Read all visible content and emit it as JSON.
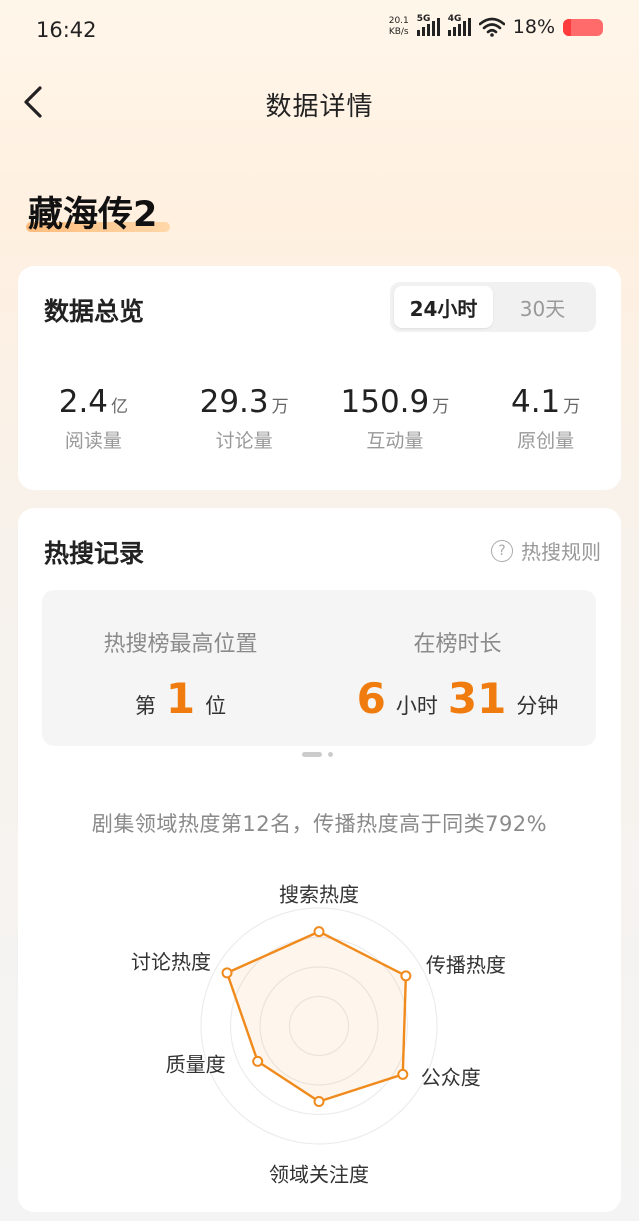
{
  "status_bar": {
    "time": "16:42",
    "net_speed_value": "20.1",
    "net_speed_unit": "KB/s",
    "signal1": "5G",
    "signal2": "4G",
    "battery": "18%"
  },
  "nav": {
    "title": "数据详情"
  },
  "topic": {
    "title": "藏海传2"
  },
  "overview": {
    "title": "数据总览",
    "tabs": [
      {
        "label": "24小时",
        "active": true
      },
      {
        "label": "30天",
        "active": false
      }
    ],
    "stats": [
      {
        "value": "2.4",
        "unit": "亿",
        "label": "阅读量"
      },
      {
        "value": "29.3",
        "unit": "万",
        "label": "讨论量"
      },
      {
        "value": "150.9",
        "unit": "万",
        "label": "互动量"
      },
      {
        "value": "4.1",
        "unit": "万",
        "label": "原创量"
      }
    ]
  },
  "hot_search": {
    "title": "热搜记录",
    "rules_label": "热搜规则",
    "rules_icon": "question-circle-icon",
    "peak_label": "热搜榜最高位置",
    "peak_prefix": "第",
    "peak_value": "1",
    "peak_suffix": "位",
    "duration_label": "在榜时长",
    "duration_hours": "6",
    "hours_unit": "小时",
    "duration_minutes": "31",
    "minutes_unit": "分钟",
    "summary": "剧集领域热度第12名，传播热度高于同类792%"
  },
  "radar": {
    "accent": "#f08a1c",
    "axes": [
      {
        "label": "搜索热度",
        "value": 0.8
      },
      {
        "label": "传播热度",
        "value": 0.85
      },
      {
        "label": "公众度",
        "value": 0.82
      },
      {
        "label": "领域关注度",
        "value": 0.64
      },
      {
        "label": "质量度",
        "value": 0.6
      },
      {
        "label": "讨论热度",
        "value": 0.9
      }
    ]
  }
}
